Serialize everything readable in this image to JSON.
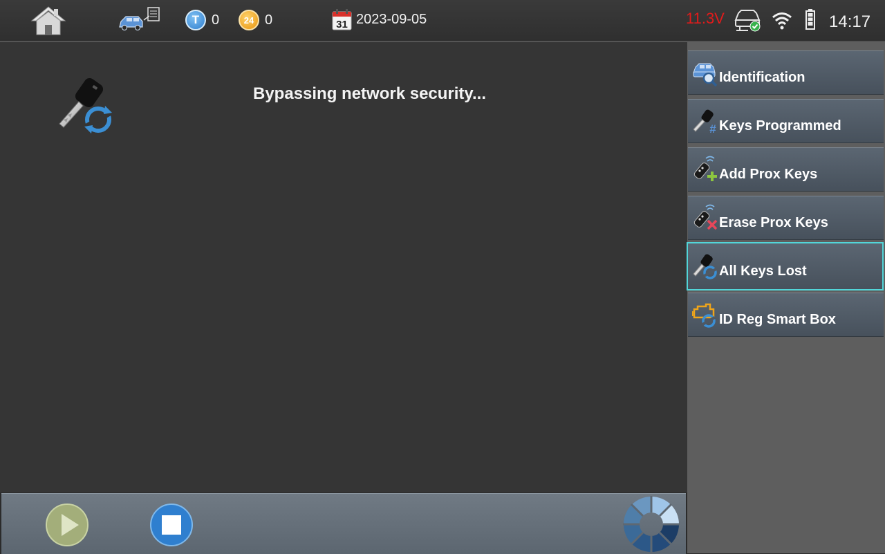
{
  "topbar": {
    "counter_t": {
      "badge": "T",
      "value": "0"
    },
    "counter_24": {
      "badge": "24",
      "value": "0"
    },
    "calendar_day": "31",
    "date": "2023-09-05",
    "voltage": "11.3V",
    "time": "14:17",
    "icons": [
      "home-icon",
      "vehicle-report-icon",
      "calendar-icon",
      "car-connected-icon",
      "wifi-icon",
      "battery-icon"
    ]
  },
  "main": {
    "status_message": "Bypassing network security...",
    "icon": "key-refresh-icon"
  },
  "bottombar": {
    "icons": [
      "play-icon",
      "stop-icon",
      "loading-spinner-icon"
    ]
  },
  "sidebar": {
    "items": [
      {
        "label": "Identification",
        "icon": "car-search-icon",
        "active": false
      },
      {
        "label": "Keys Programmed",
        "icon": "key-count-icon",
        "active": false
      },
      {
        "label": "Add Prox Keys",
        "icon": "prox-key-add-icon",
        "active": false
      },
      {
        "label": "Erase Prox Keys",
        "icon": "prox-key-erase-icon",
        "active": false
      },
      {
        "label": "All Keys Lost",
        "icon": "key-refresh-icon",
        "active": true
      },
      {
        "label": "ID Reg Smart Box",
        "icon": "smartbox-refresh-icon",
        "active": false
      }
    ]
  },
  "colors": {
    "voltage": "#e01b1b",
    "active_border": "#52d6d9",
    "accent_blue": "#2f8fd8",
    "counter_orange": "#f1a31d"
  }
}
